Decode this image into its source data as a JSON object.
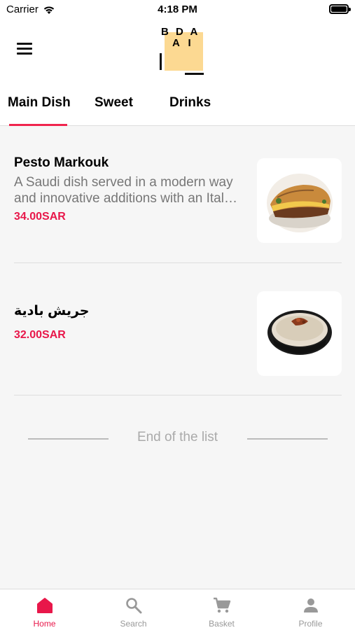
{
  "status_bar": {
    "carrier": "Carrier",
    "time": "4:18 PM"
  },
  "header": {
    "logo_row1": "B D A",
    "logo_row2": "A I"
  },
  "tabs": [
    {
      "label": "Main Dish",
      "active": true
    },
    {
      "label": "Sweet",
      "active": false
    },
    {
      "label": "Drinks",
      "active": false
    }
  ],
  "items": [
    {
      "name": "Pesto Markouk",
      "desc_line1": "A Saudi dish served in a modern way",
      "desc_line2": "and innovative additions with an Ital…",
      "price": "34.00SAR",
      "image": "sandwich-image"
    },
    {
      "name": "جريش بادية",
      "price": "32.00SAR",
      "image": "jareesh-bowl-image"
    }
  ],
  "end_of_list": "End of the list",
  "bottom_nav": [
    {
      "label": "Home",
      "icon": "home-icon",
      "active": true
    },
    {
      "label": "Search",
      "icon": "search-icon",
      "active": false
    },
    {
      "label": "Basket",
      "icon": "cart-icon",
      "active": false
    },
    {
      "label": "Profile",
      "icon": "person-icon",
      "active": false
    }
  ],
  "colors": {
    "accent": "#e8174a",
    "logo_yellow": "#fcd992"
  }
}
